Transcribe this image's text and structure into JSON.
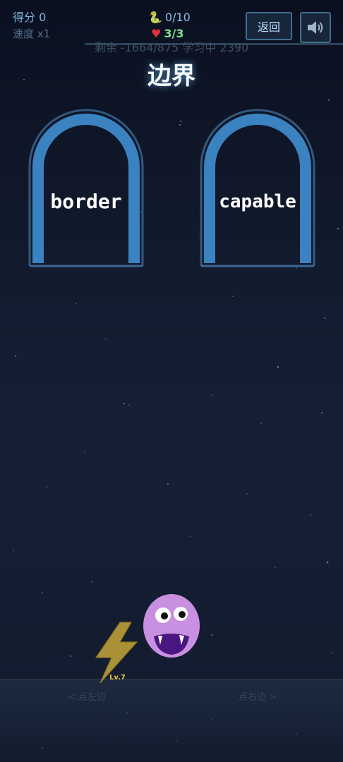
{
  "hud": {
    "score_label": "得分 0",
    "speed_label": "速度 x1",
    "snakes": "0/10",
    "lives": "3/3",
    "remaining": "剩余 -1664/875 学习中 2390"
  },
  "buttons": {
    "back_label": "返回",
    "sound_icon": "speaker-icon"
  },
  "question": {
    "word": "边界"
  },
  "doors": [
    {
      "label": "border"
    },
    {
      "label": "capable"
    }
  ],
  "player": {
    "level": "Lv.7",
    "icon": "lightning-icon",
    "monster_color": "#c98fe0"
  },
  "hints": {
    "left": "<.点左边",
    "right": "点右边 >"
  },
  "colors": {
    "door_arch": "#3a82c0",
    "lives": "#7ee08a",
    "title_glow": "#78c8ff"
  }
}
